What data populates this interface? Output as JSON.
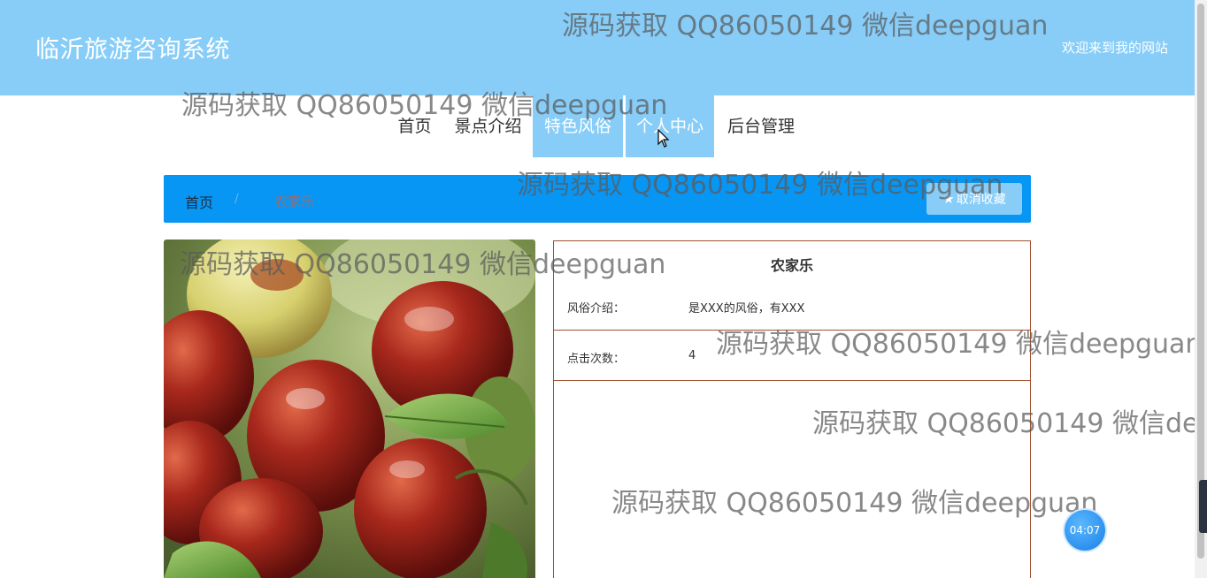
{
  "header": {
    "site_title": "临沂旅游咨询系统",
    "welcome": "欢迎来到我的网站"
  },
  "nav": {
    "items": [
      {
        "label": "首页"
      },
      {
        "label": "景点介绍"
      },
      {
        "label": "特色风俗",
        "active": true
      },
      {
        "label": "个人中心",
        "active": true
      },
      {
        "label": "后台管理"
      }
    ]
  },
  "breadcrumb": {
    "home": "首页",
    "separator": "/",
    "current": "农家乐",
    "favorite_button": "取消收藏",
    "favorite_icon": "star-icon"
  },
  "detail": {
    "title": "农家乐",
    "rows": [
      {
        "label": "风俗介绍：",
        "value": "是XXX的风俗，有XXX"
      },
      {
        "label": "点击次数：",
        "value": "4"
      }
    ]
  },
  "image": {
    "subject": "red-jujube-photo"
  },
  "watermark": {
    "text": "源码获取 QQ86050149 微信deepguan"
  },
  "timer": {
    "value": "04:07"
  },
  "colors": {
    "header_bg": "#87cdf8",
    "breadcrumb_bg": "#0896f5",
    "active_nav_bg": "#87cdf8",
    "detail_border": "#a0522d"
  }
}
